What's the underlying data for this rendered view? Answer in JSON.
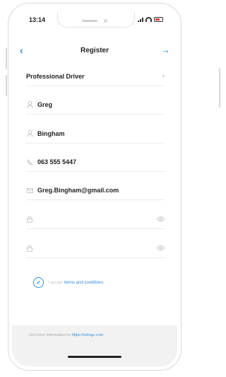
{
  "status": {
    "time": "13:14"
  },
  "nav": {
    "back": "‹",
    "title": "Register",
    "next": "→"
  },
  "form": {
    "role": "Professional Driver",
    "first_name": "Greg",
    "last_name": "Bingham",
    "phone": "063 555 5447",
    "email": "Greg.Bingham@gmail.com",
    "password": "",
    "confirm_password": ""
  },
  "terms": {
    "checked": true,
    "accept_text": "I accept",
    "link_text": "terms and conditions"
  },
  "footer": {
    "info_text": "Get more information on",
    "link": "https://ezlogz.com"
  },
  "icons": {
    "back": "chevron-left-icon",
    "next": "arrow-right-icon",
    "user": "user-icon",
    "phone": "phone-icon",
    "email": "envelope-icon",
    "lock": "lock-icon",
    "eye": "eye-icon",
    "check": "check-circle-icon"
  },
  "colors": {
    "accent": "#2f8fd8",
    "footer_bg": "#f2f2f2",
    "text": "#222222"
  }
}
